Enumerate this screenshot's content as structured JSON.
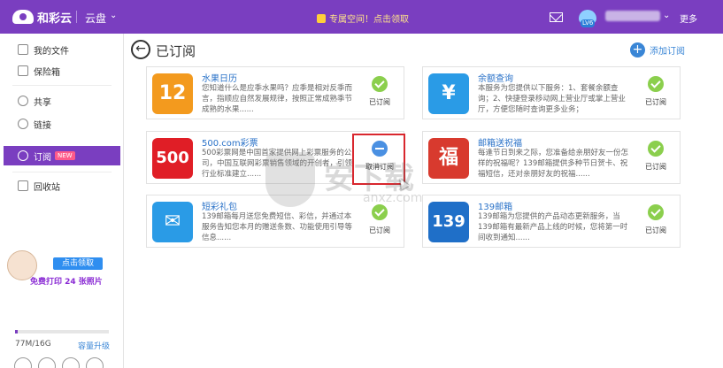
{
  "topbar": {
    "logo_text": "和彩云",
    "section": "云盘",
    "promo": "专属空间！点击领取",
    "vip": "LV6",
    "more": "更多"
  },
  "sidebar": {
    "items": [
      {
        "label": "我的文件",
        "icon": "folder-icon"
      },
      {
        "label": "保险箱",
        "icon": "safe-icon"
      },
      {
        "label": "共享",
        "icon": "share-icon"
      },
      {
        "label": "链接",
        "icon": "link-icon"
      },
      {
        "label": "订阅",
        "icon": "rss-icon",
        "badge": "NEW",
        "active": true
      },
      {
        "label": "回收站",
        "icon": "trash-icon"
      }
    ],
    "promo_button": "点击领取",
    "promo_text": "免费打印 24 张照片",
    "storage_text": "77M/16G",
    "storage_fraction": 0.0048,
    "upgrade": "容量升级"
  },
  "main": {
    "title": "已订阅",
    "add_label": "添加订阅",
    "cards": [
      {
        "title": "水果日历",
        "desc": "您知道什么是应季水果吗？应季是相对反季而言，指顺应自然发展规律，按照正常成熟季节成熟的水果......",
        "status": "已订阅",
        "icon_text": "12",
        "icon_color": "#f39a1e"
      },
      {
        "title": "余额查询",
        "desc": "本服务为您提供以下服务：1、套餐余额查询；2、快捷登录移动网上营业厅或掌上营业厅，方便您随时查询更多业务；",
        "status": "已订阅",
        "icon_text": "¥",
        "icon_color": "#2a9be6"
      },
      {
        "title": "500.com彩票",
        "desc": "500彩票网是中国首家提供网上彩票服务的公司，中国互联网彩票销售领域的开创者，引领行业标准建立......",
        "status": "取消订阅",
        "icon_text": "500",
        "icon_color": "#e01e26"
      },
      {
        "title": "邮箱送祝福",
        "desc": "每逢节日到来之际，您准备给亲朋好友一份怎样的祝福呢？139邮箱提供多种节日贺卡、祝福短信，还对亲朋好友的祝福......",
        "status": "已订阅",
        "icon_text": "福",
        "icon_color": "#d83a2e"
      },
      {
        "title": "短彩礼包",
        "desc": "139邮箱每月送您免费短信、彩信，并通过本服务告知您本月的赠送条数、功能使用引导等信息......",
        "status": "已订阅",
        "icon_text": "✉",
        "icon_color": "#2a9be6"
      },
      {
        "title": "139邮箱",
        "desc": "139邮箱为您提供的产品动态更新服务，当139邮箱有最新产品上线的时候，您将第一时间收到通知......",
        "status": "已订阅",
        "icon_text": "139",
        "icon_color": "#1f6fc8"
      }
    ]
  },
  "watermark": {
    "text": "安下载",
    "sub": "anxz.com"
  }
}
